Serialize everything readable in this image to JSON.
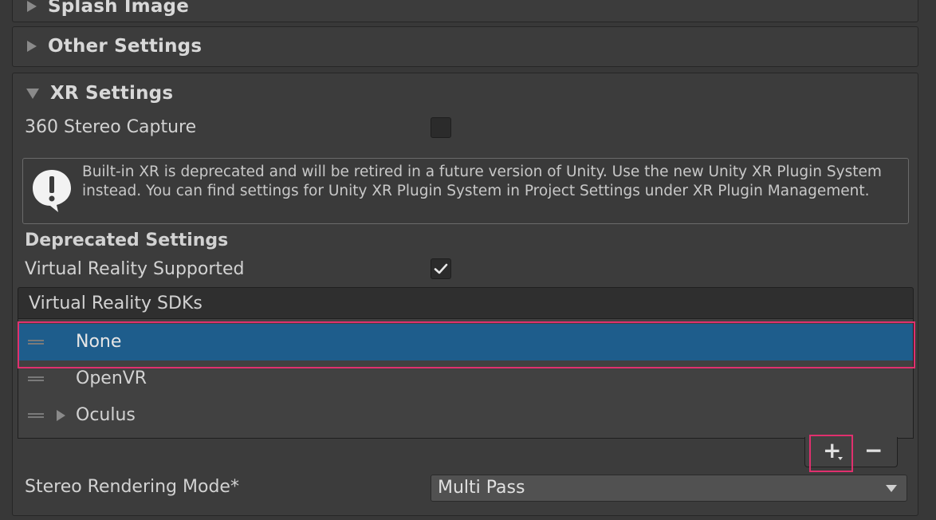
{
  "sections": {
    "splash_image": {
      "title": "Splash Image"
    },
    "other_settings": {
      "title": "Other Settings"
    },
    "xr_settings": {
      "title": "XR Settings"
    }
  },
  "xr": {
    "stereo_capture_label": "360 Stereo Capture",
    "stereo_capture_checked": false,
    "help_message": "Built-in XR is deprecated and will be retired in a future version of Unity. Use the new Unity XR Plugin System instead. You can find settings for Unity XR Plugin System in Project Settings under XR Plugin Management.",
    "deprecated_heading": "Deprecated Settings",
    "vr_supported_label": "Virtual Reality Supported",
    "vr_supported_checked": true,
    "sdk_list": {
      "header": "Virtual Reality SDKs",
      "items": [
        {
          "label": "None",
          "selected": true,
          "expandable": false
        },
        {
          "label": "OpenVR",
          "selected": false,
          "expandable": false
        },
        {
          "label": "Oculus",
          "selected": false,
          "expandable": true
        }
      ],
      "add_label": "+",
      "remove_label": "−"
    },
    "stereo_rendering_label": "Stereo Rendering Mode*",
    "stereo_rendering_value": "Multi Pass"
  },
  "colors": {
    "selection": "#1e5d8c",
    "highlight": "#e0306e",
    "background": "#383838"
  }
}
